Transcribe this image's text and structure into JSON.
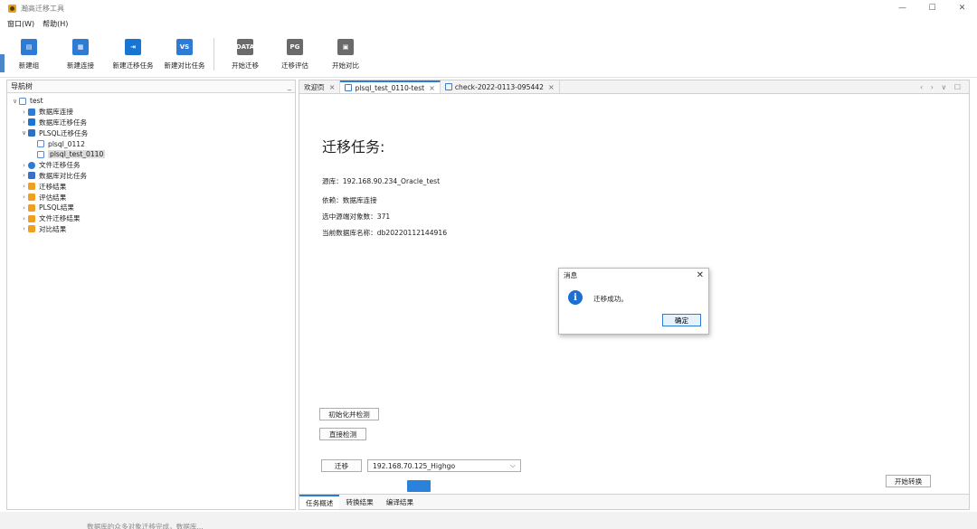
{
  "window": {
    "title": "瀚高迁移工具",
    "controls": [
      "—",
      "☐",
      "✕"
    ]
  },
  "menu": [
    "窗口(W)",
    "帮助(H)"
  ],
  "toolbar": [
    {
      "id": "new-group",
      "label": "新建组",
      "icon": "new-group-icon",
      "color": "#2e7bd4",
      "glyph": "▤"
    },
    {
      "id": "new-connection",
      "label": "新建连接",
      "icon": "new-connection-icon",
      "color": "#2e7bd4",
      "glyph": "▦"
    },
    {
      "id": "new-migration-task",
      "label": "新建迁移任务",
      "icon": "new-migration-task-icon",
      "color": "#1875d1",
      "glyph": "⇥"
    },
    {
      "id": "new-compare-task",
      "label": "新建对比任务",
      "icon": "new-compare-task-icon",
      "color": "#2e7bd4",
      "glyph": "VS"
    },
    {
      "id": "start-migration",
      "label": "开始迁移",
      "icon": "start-migration-icon",
      "color": "#6a6a6a",
      "glyph": "DATA"
    },
    {
      "id": "migration-evaluation",
      "label": "迁移评估",
      "icon": "migration-evaluation-icon",
      "color": "#6a6a6a",
      "glyph": "PG"
    },
    {
      "id": "start-compare",
      "label": "开始对比",
      "icon": "start-compare-icon",
      "color": "#6a6a6a",
      "glyph": "▣"
    }
  ],
  "nav": {
    "title": "导航树",
    "minimize": "_",
    "tree": [
      {
        "label": "test",
        "level": 0,
        "twisty": "∨",
        "icon": "root"
      },
      {
        "label": "数据库连接",
        "level": 1,
        "twisty": "›",
        "icon": "db"
      },
      {
        "label": "数据库迁移任务",
        "level": 1,
        "twisty": "›",
        "icon": "mig"
      },
      {
        "label": "PLSQL迁移任务",
        "level": 1,
        "twisty": "∨",
        "icon": "pl"
      },
      {
        "label": "plsql_0112",
        "level": 2,
        "twisty": "",
        "icon": "doc"
      },
      {
        "label": "plsql_test_0110",
        "level": 2,
        "twisty": "",
        "icon": "doc",
        "selected": true
      },
      {
        "label": "文件迁移任务",
        "level": 1,
        "twisty": "›",
        "icon": "file"
      },
      {
        "label": "数据库对比任务",
        "level": 1,
        "twisty": "›",
        "icon": "vs"
      },
      {
        "label": "迁移结果",
        "level": 1,
        "twisty": "›",
        "icon": "folder"
      },
      {
        "label": "评估结果",
        "level": 1,
        "twisty": "›",
        "icon": "folder"
      },
      {
        "label": "PLSQL结果",
        "level": 1,
        "twisty": "›",
        "icon": "folder"
      },
      {
        "label": "文件迁移结果",
        "level": 1,
        "twisty": "›",
        "icon": "folder"
      },
      {
        "label": "对比结果",
        "level": 1,
        "twisty": "›",
        "icon": "folder"
      }
    ]
  },
  "tabs": [
    {
      "label": "欢迎页",
      "active": false,
      "icon": false
    },
    {
      "label": "plsql_test_0110-test",
      "active": true,
      "icon": true
    },
    {
      "label": "check-2022-0113-095442",
      "active": false,
      "icon": true
    }
  ],
  "tab_controls": "‹ › ∨ ☐",
  "content": {
    "title": "迁移任务:",
    "source": "源库：192.168.90.234_Oracle_test",
    "depends": "依赖：数据库连接",
    "selected_count": "选中源端对象数：371",
    "current_db": "当前数据库名称：db20220112144916",
    "init_check_button": "初始化并检测",
    "direct_check_button": "直接检测",
    "migrate_button": "迁移",
    "target_select": "192.168.70.125_Highgo",
    "start_convert_button": "开始转换"
  },
  "bottom_tabs": [
    {
      "label": "任务概述",
      "active": true
    },
    {
      "label": "转换结果",
      "active": false
    },
    {
      "label": "编译结果",
      "active": false
    }
  ],
  "dialog": {
    "title": "消息",
    "message": "迁移成功。",
    "ok": "确定",
    "close": "✕"
  },
  "status": {
    "text": "数据库的众多对象迁移完成，数据库..."
  }
}
